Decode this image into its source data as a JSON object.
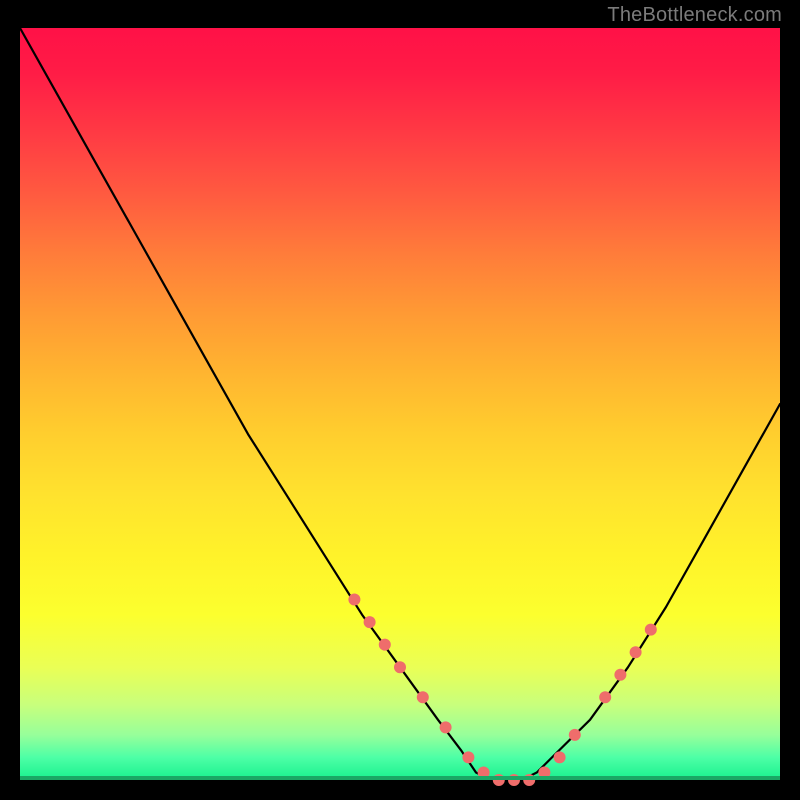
{
  "watermark": "TheBottleneck.com",
  "colors": {
    "background": "#000000",
    "curve": "#000000",
    "marker": "#ef6d6b",
    "gradient_top": "#ff1147",
    "gradient_mid": "#ffe22e",
    "gradient_bottom": "#18f08e"
  },
  "chart_data": {
    "type": "line",
    "title": "",
    "xlabel": "",
    "ylabel": "",
    "xlim": [
      0,
      100
    ],
    "ylim": [
      0,
      100
    ],
    "grid": false,
    "legend": false,
    "series": [
      {
        "name": "bottleneck-curve",
        "x": [
          0,
          5,
          10,
          15,
          20,
          25,
          30,
          35,
          40,
          45,
          50,
          55,
          58,
          60,
          62,
          64,
          66,
          68,
          70,
          75,
          80,
          85,
          90,
          95,
          100
        ],
        "y": [
          100,
          91,
          82,
          73,
          64,
          55,
          46,
          38,
          30,
          22,
          15,
          8,
          4,
          1,
          0,
          0,
          0,
          1,
          3,
          8,
          15,
          23,
          32,
          41,
          50
        ]
      }
    ],
    "markers": {
      "name": "highlight-points",
      "x": [
        44,
        46,
        48,
        50,
        53,
        56,
        59,
        61,
        63,
        65,
        67,
        69,
        71,
        73,
        77,
        79,
        81,
        83
      ],
      "y": [
        24,
        21,
        18,
        15,
        11,
        7,
        3,
        1,
        0,
        0,
        0,
        1,
        3,
        6,
        11,
        14,
        17,
        20
      ]
    }
  }
}
